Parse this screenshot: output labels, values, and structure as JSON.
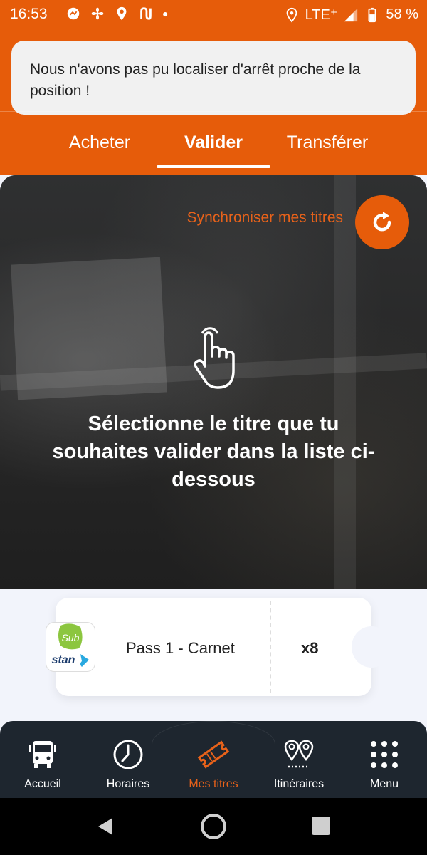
{
  "status_bar": {
    "time": "16:53",
    "network": "LTE⁺",
    "battery": "58 %"
  },
  "alert": {
    "message": "Nous n'avons pas pu localiser d'arrêt proche de la position !"
  },
  "tabs": [
    {
      "label": "Acheter"
    },
    {
      "label": "Valider",
      "active": true
    },
    {
      "label": "Transférer"
    }
  ],
  "scanner": {
    "sync_label": "Synchroniser mes titres",
    "instruction": "Sélectionne le titre que tu souhaites valider dans la liste ci-dessous"
  },
  "ticket": {
    "logo_top": "Sub",
    "logo_bottom": "stan",
    "name": "Pass 1 - Carnet",
    "count": "x8"
  },
  "bottom_nav": [
    {
      "label": "Accueil",
      "icon": "bus-icon"
    },
    {
      "label": "Horaires",
      "icon": "clock-icon"
    },
    {
      "label": "Mes titres",
      "icon": "ticket-icon",
      "active": true
    },
    {
      "label": "Itinéraires",
      "icon": "route-pins-icon"
    },
    {
      "label": "Menu",
      "icon": "grid-menu-icon"
    }
  ],
  "colors": {
    "brand_orange": "#e65c0a",
    "nav_background": "#1e262f"
  }
}
